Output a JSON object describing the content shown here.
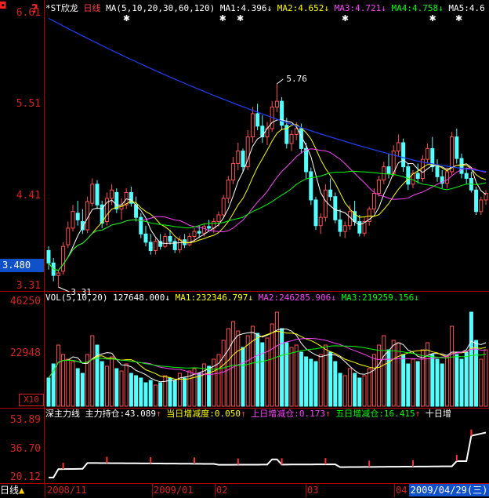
{
  "header": {
    "stock_name": "*ST欣龙",
    "period": "日线",
    "ma_params": "MA(5,10,20,30,60,120)",
    "ma": [
      {
        "label": "MA1:",
        "value": "4.396",
        "arrow": "↓",
        "color": "#ffffff"
      },
      {
        "label": "MA2:",
        "value": "4.652",
        "arrow": "↓",
        "color": "#ffff00"
      },
      {
        "label": "MA3:",
        "value": "4.721",
        "arrow": "↓",
        "color": "#ff40ff"
      },
      {
        "label": "MA4:",
        "value": "4.758",
        "arrow": "↓",
        "color": "#00ff00"
      },
      {
        "label": "MA5:",
        "value": "4.6",
        "arrow": "↓",
        "color": "#ffffff"
      }
    ]
  },
  "price_axis": {
    "ticks": [
      "6.61",
      "5.51",
      "4.41",
      "3.31"
    ],
    "current": "3.480"
  },
  "annotations": {
    "high": "5.76",
    "low": "3.31"
  },
  "volume_header": {
    "params": "VOL(5,10,20)",
    "vol": "127648.000",
    "ma1_label": "MA1:",
    "ma1": "232346.797",
    "ma2_label": "MA2:",
    "ma2": "246285.906",
    "ma3_label": "MA3:",
    "ma3": "219259.156",
    "arrow": "↓"
  },
  "volume_axis": {
    "ticks": [
      "46250",
      "22948"
    ],
    "multiplier": "X10"
  },
  "indicator_header": {
    "name": "深主力线",
    "holding_label": "主力持仓:",
    "holding": "43.089",
    "daily_label": "当日增减度:",
    "daily": "0.050",
    "up_label": "上日增减仓:",
    "up": "0.173",
    "five_label": "五日增减仓:",
    "five": "16.415",
    "ten_label": "十日增",
    "arrow": "↑"
  },
  "indicator_axis": {
    "ticks": [
      "53.89",
      "36.70",
      "20.12"
    ]
  },
  "bottom": {
    "period_tab": "日线",
    "dates": [
      "2008/11",
      "2009/01",
      "02",
      "03",
      "04"
    ],
    "current_date": "2009/04/29(三)"
  },
  "colors": {
    "up": "#ff5050",
    "down": "#54ffff",
    "axis": "#d82020",
    "grid_border": "#b00000",
    "highlight_blue": "#1050c8"
  },
  "chart_data": {
    "type": "candlestick",
    "x_start": "2008-11",
    "x_end": "2009-04-29",
    "ylim": [
      3.31,
      6.61
    ],
    "high_marker": 5.76,
    "low_marker": 3.31,
    "ohlc": [
      [
        3.75,
        3.8,
        3.52,
        3.6
      ],
      [
        3.6,
        3.66,
        3.38,
        3.45
      ],
      [
        3.45,
        3.52,
        3.31,
        3.48
      ],
      [
        3.5,
        3.85,
        3.46,
        3.8
      ],
      [
        3.82,
        4.1,
        3.78,
        4.02
      ],
      [
        4.02,
        4.3,
        3.98,
        4.22
      ],
      [
        4.2,
        4.35,
        4.05,
        4.12
      ],
      [
        4.1,
        4.25,
        3.95,
        4.0
      ],
      [
        4.0,
        4.4,
        3.96,
        4.34
      ],
      [
        4.32,
        4.62,
        4.28,
        4.55
      ],
      [
        4.55,
        4.6,
        4.25,
        4.3
      ],
      [
        4.3,
        4.35,
        4.02,
        4.08
      ],
      [
        4.1,
        4.45,
        4.05,
        4.38
      ],
      [
        4.38,
        4.55,
        4.3,
        4.48
      ],
      [
        4.45,
        4.5,
        4.2,
        4.25
      ],
      [
        4.25,
        4.38,
        4.12,
        4.3
      ],
      [
        4.3,
        4.5,
        4.25,
        4.45
      ],
      [
        4.45,
        4.52,
        4.28,
        4.32
      ],
      [
        4.3,
        4.4,
        4.1,
        4.15
      ],
      [
        4.15,
        4.2,
        3.9,
        3.95
      ],
      [
        3.95,
        4.05,
        3.8,
        3.85
      ],
      [
        3.85,
        3.95,
        3.7,
        3.75
      ],
      [
        3.75,
        3.9,
        3.7,
        3.86
      ],
      [
        3.86,
        3.95,
        3.76,
        3.8
      ],
      [
        3.8,
        3.96,
        3.78,
        3.92
      ],
      [
        3.92,
        4.0,
        3.82,
        3.86
      ],
      [
        3.86,
        3.9,
        3.72,
        3.76
      ],
      [
        3.76,
        3.92,
        3.72,
        3.88
      ],
      [
        3.88,
        3.95,
        3.78,
        3.82
      ],
      [
        3.82,
        3.96,
        3.8,
        3.92
      ],
      [
        3.92,
        4.02,
        3.86,
        3.98
      ],
      [
        3.98,
        4.05,
        3.9,
        3.96
      ],
      [
        3.96,
        4.08,
        3.92,
        4.04
      ],
      [
        4.04,
        4.12,
        3.98,
        4.02
      ],
      [
        4.02,
        4.14,
        3.96,
        4.1
      ],
      [
        4.1,
        4.22,
        4.04,
        4.18
      ],
      [
        4.18,
        4.42,
        4.15,
        4.38
      ],
      [
        4.38,
        4.65,
        4.32,
        4.6
      ],
      [
        4.6,
        4.88,
        4.55,
        4.8
      ],
      [
        4.8,
        5.05,
        4.72,
        4.95
      ],
      [
        4.95,
        4.98,
        4.7,
        4.76
      ],
      [
        4.76,
        5.2,
        4.72,
        5.12
      ],
      [
        5.12,
        5.48,
        5.05,
        5.4
      ],
      [
        5.4,
        5.52,
        5.2,
        5.25
      ],
      [
        5.25,
        5.38,
        5.05,
        5.12
      ],
      [
        5.12,
        5.3,
        5.02,
        5.22
      ],
      [
        5.22,
        5.55,
        5.18,
        5.48
      ],
      [
        5.48,
        5.76,
        5.42,
        5.55
      ],
      [
        5.55,
        5.6,
        5.2,
        5.26
      ],
      [
        5.26,
        5.35,
        4.98,
        5.04
      ],
      [
        5.04,
        5.2,
        4.95,
        5.15
      ],
      [
        5.15,
        5.3,
        5.08,
        5.22
      ],
      [
        5.22,
        5.28,
        4.92,
        4.98
      ],
      [
        4.98,
        5.05,
        4.62,
        4.7
      ],
      [
        4.7,
        4.75,
        4.3,
        4.36
      ],
      [
        4.36,
        4.4,
        4.0,
        4.05
      ],
      [
        4.05,
        4.2,
        3.95,
        4.15
      ],
      [
        4.15,
        4.55,
        4.1,
        4.48
      ],
      [
        4.48,
        4.62,
        4.35,
        4.4
      ],
      [
        4.4,
        4.45,
        4.08,
        4.12
      ],
      [
        4.12,
        4.25,
        3.92,
        3.98
      ],
      [
        3.98,
        4.1,
        3.9,
        4.05
      ],
      [
        4.05,
        4.3,
        4.0,
        4.22
      ],
      [
        4.22,
        4.35,
        4.05,
        4.1
      ],
      [
        4.1,
        4.18,
        3.92,
        3.96
      ],
      [
        3.96,
        4.15,
        3.92,
        4.1
      ],
      [
        4.1,
        4.28,
        4.05,
        4.25
      ],
      [
        4.25,
        4.5,
        4.2,
        4.44
      ],
      [
        4.44,
        4.65,
        4.4,
        4.6
      ],
      [
        4.6,
        4.82,
        4.55,
        4.76
      ],
      [
        4.76,
        4.92,
        4.62,
        4.68
      ],
      [
        4.68,
        5.02,
        4.64,
        4.95
      ],
      [
        4.95,
        5.15,
        4.88,
        5.05
      ],
      [
        5.05,
        5.1,
        4.7,
        4.76
      ],
      [
        4.76,
        4.8,
        4.48,
        4.55
      ],
      [
        4.55,
        4.72,
        4.5,
        4.68
      ],
      [
        4.68,
        4.8,
        4.56,
        4.62
      ],
      [
        4.62,
        4.9,
        4.58,
        4.85
      ],
      [
        4.85,
        5.04,
        4.8,
        4.98
      ],
      [
        4.98,
        5.12,
        4.7,
        4.76
      ],
      [
        4.76,
        4.85,
        4.58,
        4.64
      ],
      [
        4.64,
        4.72,
        4.5,
        4.56
      ],
      [
        4.56,
        4.75,
        4.5,
        4.7
      ],
      [
        4.7,
        5.18,
        4.66,
        5.12
      ],
      [
        5.12,
        5.22,
        4.8,
        4.86
      ],
      [
        4.86,
        4.92,
        4.62,
        4.68
      ],
      [
        4.68,
        4.75,
        4.55,
        4.62
      ],
      [
        4.62,
        4.7,
        4.45,
        4.48
      ],
      [
        4.48,
        4.52,
        4.18,
        4.22
      ],
      [
        4.22,
        4.4,
        4.18,
        4.36
      ],
      [
        4.36,
        4.48,
        4.3,
        4.44
      ]
    ],
    "volume": [
      12,
      18,
      26,
      22,
      20,
      19,
      16,
      14,
      22,
      30,
      26,
      19,
      17,
      21,
      16,
      15,
      18,
      14,
      13,
      12,
      10,
      11,
      9,
      10,
      13,
      12,
      11,
      14,
      12,
      15,
      16,
      14,
      18,
      17,
      20,
      22,
      28,
      33,
      36,
      32,
      25,
      30,
      34,
      31,
      27,
      29,
      35,
      40,
      33,
      27,
      25,
      26,
      23,
      21,
      20,
      19,
      22,
      26,
      23,
      19,
      14,
      13,
      16,
      14,
      12,
      13,
      16,
      22,
      26,
      30,
      24,
      28,
      27,
      22,
      18,
      20,
      19,
      24,
      27,
      22,
      20,
      18,
      21,
      34,
      22,
      20,
      23,
      40,
      28,
      20,
      24
    ]
  }
}
